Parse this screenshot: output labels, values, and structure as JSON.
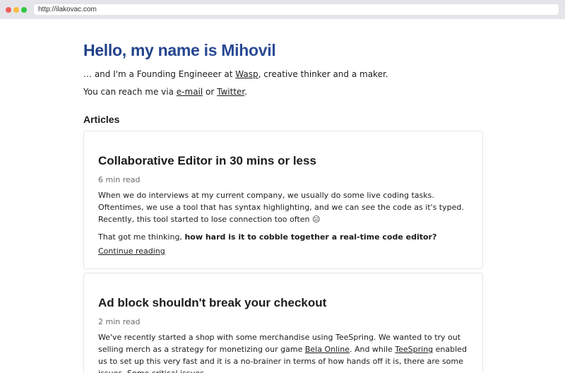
{
  "browser": {
    "url": "http://ilakovac.com"
  },
  "hero": {
    "title": "Hello, my name is Mihovil",
    "intro_prefix": "… and I'm a Founding Engineeer at ",
    "intro_link": "Wasp",
    "intro_suffix": ", creative thinker and a maker.",
    "contact_prefix": "You can reach me via ",
    "contact_email": "e-mail",
    "contact_or": " or ",
    "contact_twitter": "Twitter",
    "contact_suffix": "."
  },
  "articles": {
    "heading": "Articles",
    "items": [
      {
        "title": "Collaborative Editor in 30 mins or less",
        "read_time": "6 min read",
        "p1": "When we do interviews at my current company, we usually do some live coding tasks. Oftentimes, we use a tool that has syntax highlighting, and we can see the code as it's typed. Recently, this tool started to lose connection too often 😑",
        "p2_prefix": "That got me thinking, ",
        "p2_bold": "how hard is it to cobble together a real-time code editor?",
        "continue": "Continue reading"
      },
      {
        "title": "Ad block shouldn't break your checkout",
        "read_time": "2 min read",
        "p1_a": "We've recently started a shop with some merchandise using TeeSpring. We wanted to try out selling merch as a strategy for monetizing our game ",
        "p1_link1": "Bela Online",
        "p1_b": ". And while ",
        "p1_link2": "TeeSpring",
        "p1_c": " enabled us to set up this very fast and it is a no-brainer in terms of how hands off it is, there are some issues. Some critical issues."
      }
    ]
  }
}
